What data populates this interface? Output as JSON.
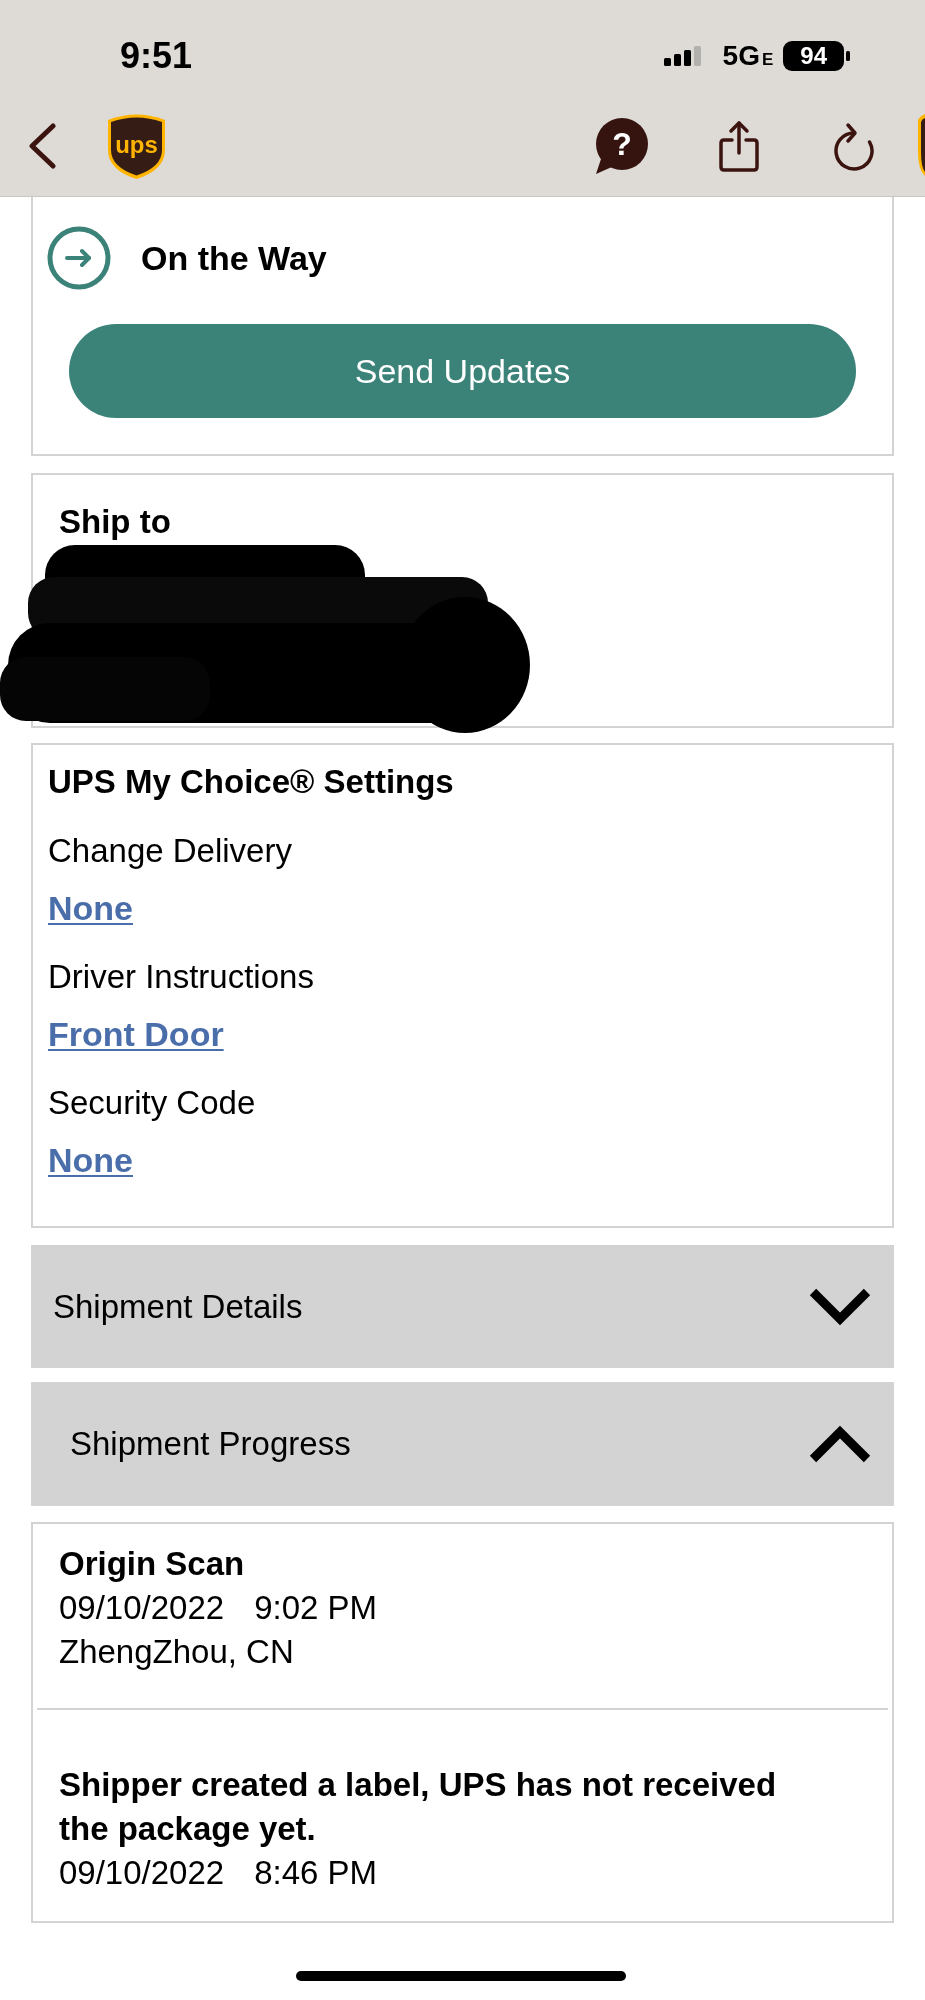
{
  "status_bar": {
    "time": "9:51",
    "network": "5G",
    "network_suffix": "E",
    "battery": "94"
  },
  "nav": {
    "logo_text": "ups",
    "help_glyph": "?"
  },
  "status_card": {
    "status": "On the Way",
    "button": "Send Updates"
  },
  "ship_to": {
    "title": "Ship to",
    "address_redacted": true
  },
  "settings": {
    "title": "UPS My Choice® Settings",
    "items": [
      {
        "label": "Change Delivery",
        "value": "None"
      },
      {
        "label": "Driver Instructions",
        "value": "Front Door"
      },
      {
        "label": "Security Code",
        "value": "None"
      }
    ]
  },
  "sections": [
    {
      "title": "Shipment Details",
      "expanded": false
    },
    {
      "title": "Shipment Progress",
      "expanded": true,
      "events": [
        {
          "title": "Origin Scan",
          "date": "09/10/2022",
          "time": "9:02 PM",
          "location": "ZhengZhou, CN"
        },
        {
          "title": "Shipper created a label, UPS has not received the package yet.",
          "date": "09/10/2022",
          "time": "8:46 PM"
        }
      ]
    }
  ]
}
